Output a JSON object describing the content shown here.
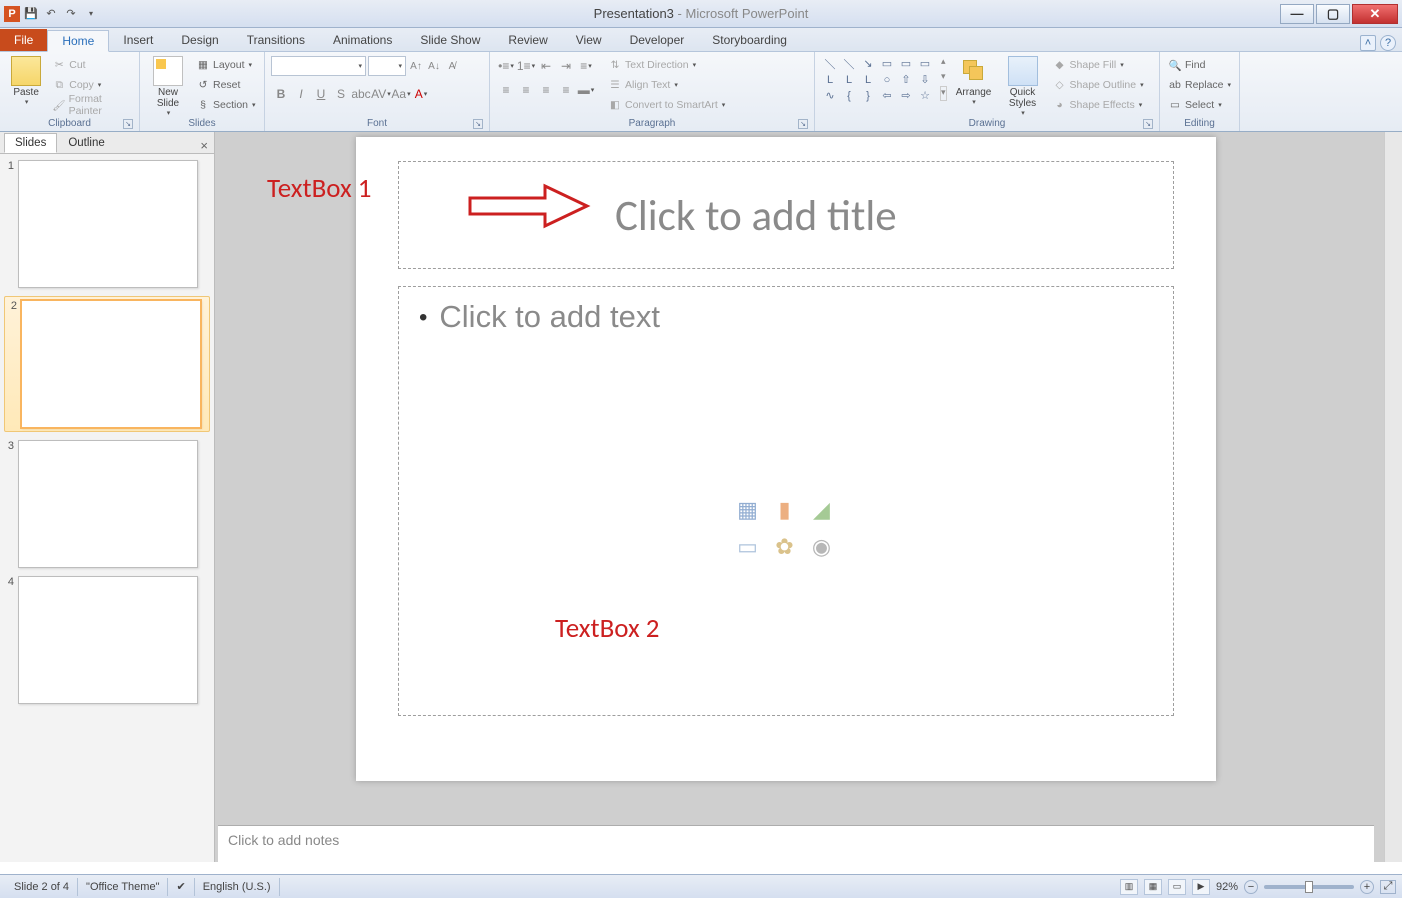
{
  "titlebar": {
    "docname": "Presentation3",
    "appname": "Microsoft PowerPoint"
  },
  "tabs": {
    "file": "File",
    "home": "Home",
    "insert": "Insert",
    "design": "Design",
    "transitions": "Transitions",
    "animations": "Animations",
    "slideshow": "Slide Show",
    "review": "Review",
    "view": "View",
    "developer": "Developer",
    "storyboarding": "Storyboarding"
  },
  "ribbon": {
    "clipboard": {
      "label": "Clipboard",
      "paste": "Paste",
      "cut": "Cut",
      "copy": "Copy",
      "format_painter": "Format Painter"
    },
    "slides": {
      "label": "Slides",
      "new_slide": "New\nSlide",
      "layout": "Layout",
      "reset": "Reset",
      "section": "Section"
    },
    "font": {
      "label": "Font"
    },
    "paragraph": {
      "label": "Paragraph",
      "text_direction": "Text Direction",
      "align_text": "Align Text",
      "smartart": "Convert to SmartArt"
    },
    "drawing": {
      "label": "Drawing",
      "arrange": "Arrange",
      "quick_styles": "Quick\nStyles",
      "shape_fill": "Shape Fill",
      "shape_outline": "Shape Outline",
      "shape_effects": "Shape Effects"
    },
    "editing": {
      "label": "Editing",
      "find": "Find",
      "replace": "Replace",
      "select": "Select"
    }
  },
  "sidepanel": {
    "slides_tab": "Slides",
    "outline_tab": "Outline",
    "thumbs": [
      "1",
      "2",
      "3",
      "4"
    ]
  },
  "slide": {
    "title_placeholder": "Click to add title",
    "body_placeholder": "Click to add text"
  },
  "annotations": {
    "textbox1": "TextBox 1",
    "textbox2": "TextBox 2"
  },
  "notes": {
    "placeholder": "Click to add notes"
  },
  "status": {
    "slide_pos": "Slide 2 of 4",
    "theme": "\"Office Theme\"",
    "lang": "English (U.S.)",
    "zoom": "92%"
  }
}
